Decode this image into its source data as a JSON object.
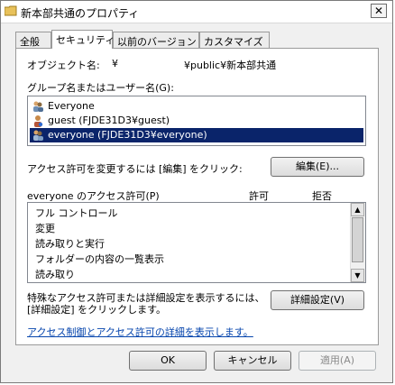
{
  "window": {
    "title": "新本部共通のプロパティ",
    "close_glyph": "✕"
  },
  "tabs": [
    {
      "label": "全般"
    },
    {
      "label": "セキュリティ"
    },
    {
      "label": "以前のバージョン"
    },
    {
      "label": "カスタマイズ"
    }
  ],
  "object": {
    "label": "オブジェクト名:",
    "prefix": "¥",
    "path_suffix": "¥public¥新本部共通"
  },
  "groups": {
    "label": "グループ名またはユーザー名(G):",
    "items": [
      {
        "text": "Everyone",
        "icon": "user-group-icon"
      },
      {
        "text": "guest (FJDE31D3¥guest)",
        "icon": "user-icon"
      },
      {
        "text": "everyone (FJDE31D3¥everyone)",
        "icon": "user-group-icon",
        "selected": true
      }
    ]
  },
  "change_permissions": {
    "text": "アクセス許可を変更するには [編集] をクリック:",
    "button": "編集(E)..."
  },
  "permissions": {
    "title": "everyone のアクセス許可(P)",
    "allow": "許可",
    "deny": "拒否",
    "items": [
      "フル コントロール",
      "変更",
      "読み取りと実行",
      "フォルダーの内容の一覧表示",
      "読み取り"
    ]
  },
  "advanced": {
    "text_line1": "特殊なアクセス許可または詳細設定を表示するには、",
    "text_line2": "[詳細設定] をクリックします。",
    "button": "詳細設定(V)"
  },
  "link": "アクセス制御とアクセス許可の詳細を表示します。",
  "footer": {
    "ok": "OK",
    "cancel": "キャンセル",
    "apply": "適用(A)"
  },
  "colors": {
    "selection": "#0a246a",
    "link": "#0645ad"
  }
}
